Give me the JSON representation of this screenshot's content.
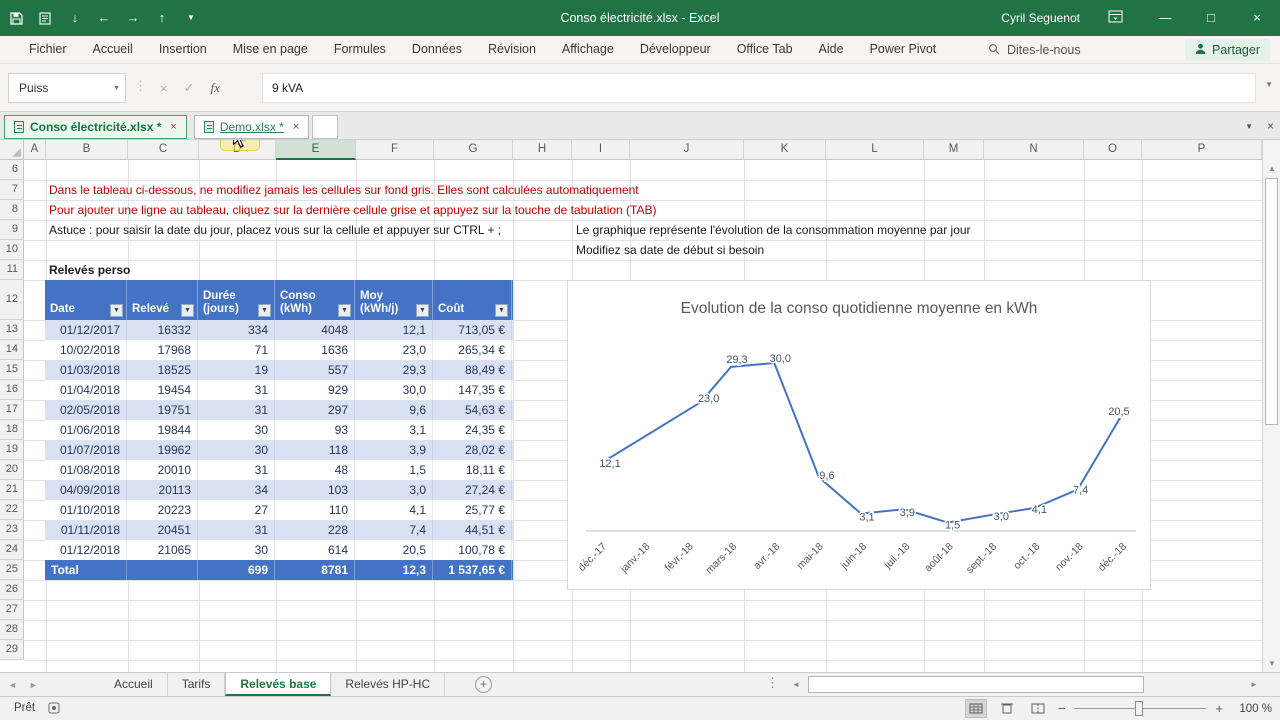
{
  "title_bar": {
    "title": "Conso électricité.xlsx - Excel",
    "user": "Cyril Seguenot"
  },
  "ribbon": {
    "tabs": [
      "Fichier",
      "Accueil",
      "Insertion",
      "Mise en page",
      "Formules",
      "Données",
      "Révision",
      "Affichage",
      "Développeur",
      "Office Tab",
      "Aide",
      "Power Pivot"
    ],
    "tell_me": "Dites-le-nous",
    "share": "Partager"
  },
  "formula_bar": {
    "name_box": "Puiss",
    "value": "9 kVA"
  },
  "workbook_tab_bar": {
    "tabs": [
      {
        "label": "Conso électricité.xlsx *",
        "active": true
      },
      {
        "label": "Demo.xlsx *",
        "active": false
      }
    ]
  },
  "sheet": {
    "columns": [
      "A",
      "B",
      "C",
      "D",
      "E",
      "F",
      "G",
      "H",
      "I",
      "J",
      "K",
      "L",
      "M",
      "N",
      "O",
      "P"
    ],
    "selected_column": "E",
    "rows_start": 6,
    "rows_end": 29
  },
  "messages": {
    "row7": "Dans le tableau ci-dessous, ne modifiez jamais les cellules sur fond gris. Elles sont calculées automatiquement",
    "row8": "Pour ajouter une ligne au tableau, cliquez sur la dernière cellule grise et appuyez sur la touche de tabulation (TAB)",
    "row9": "Astuce : pour saisir la date du jour, placez vous sur la cellule et appuyer sur CTRL + ;",
    "row9_right": "Le graphique représente l'évolution de la consommation moyenne par jour",
    "row10_right": "Modifiez sa date de début si besoin",
    "section_title": "Relevés perso"
  },
  "table": {
    "headers": [
      "Date",
      "Relevé",
      "Durée (jours)",
      "Conso (kWh)",
      "Moy (kWh/j)",
      "Coût"
    ],
    "rows": [
      [
        "01/12/2017",
        "16332",
        "334",
        "4048",
        "12,1",
        "713,05 €"
      ],
      [
        "10/02/2018",
        "17968",
        "71",
        "1636",
        "23,0",
        "265,34 €"
      ],
      [
        "01/03/2018",
        "18525",
        "19",
        "557",
        "29,3",
        "88,49 €"
      ],
      [
        "01/04/2018",
        "19454",
        "31",
        "929",
        "30,0",
        "147,35 €"
      ],
      [
        "02/05/2018",
        "19751",
        "31",
        "297",
        "9,6",
        "54,63 €"
      ],
      [
        "01/06/2018",
        "19844",
        "30",
        "93",
        "3,1",
        "24,35 €"
      ],
      [
        "01/07/2018",
        "19962",
        "30",
        "118",
        "3,9",
        "28,02 €"
      ],
      [
        "01/08/2018",
        "20010",
        "31",
        "48",
        "1,5",
        "18,11 €"
      ],
      [
        "04/09/2018",
        "20113",
        "34",
        "103",
        "3,0",
        "27,24 €"
      ],
      [
        "01/10/2018",
        "20223",
        "27",
        "110",
        "4,1",
        "25,77 €"
      ],
      [
        "01/11/2018",
        "20451",
        "31",
        "228",
        "7,4",
        "44,51 €"
      ],
      [
        "01/12/2018",
        "21065",
        "30",
        "614",
        "20,5",
        "100,78 €"
      ]
    ],
    "total": [
      "Total",
      "",
      "699",
      "8781",
      "12,3",
      "1 537,65 €"
    ]
  },
  "chart_data": {
    "type": "line",
    "title": "Evolution de la conso quotidienne moyenne en kWh",
    "x_tick_labels": [
      "déc.-17",
      "janv.-18",
      "févr.-18",
      "mars-18",
      "avr.-18",
      "mai-18",
      "juin-18",
      "juil.-18",
      "août-18",
      "sept.-18",
      "oct.-18",
      "nov.-18",
      "déc.-18"
    ],
    "x_axis_span_months": 12,
    "series": [
      {
        "name": "Moy (kWh/j)",
        "x_months": [
          0,
          2.3,
          3,
          4,
          5.03,
          6,
          7,
          8,
          9.1,
          10,
          11,
          12
        ],
        "values": [
          12.1,
          23.0,
          29.3,
          30.0,
          9.6,
          3.1,
          3.9,
          1.5,
          3.0,
          4.1,
          7.4,
          20.5
        ],
        "point_labels": [
          "12,1",
          "23,0",
          "29,3",
          "30,0",
          "9,6",
          "3,1",
          "3,9",
          "1,5",
          "3,0",
          "4,1",
          "7,4",
          "20,5"
        ]
      }
    ],
    "ylim": [
      0,
      30
    ],
    "gridlines": false,
    "legend": "none",
    "line_color": "#4472C4",
    "label_color": "#44546A",
    "axis_text_color": "#595959"
  },
  "sheet_tab_bar": {
    "tabs": [
      {
        "label": "Accueil",
        "active": false
      },
      {
        "label": "Tarifs",
        "active": false
      },
      {
        "label": "Relevés base",
        "active": true
      },
      {
        "label": "Relevés HP-HC",
        "active": false
      }
    ]
  },
  "status_bar": {
    "mode": "Prêt",
    "zoom": "100 %"
  },
  "colors": {
    "titlebar_green": "#217346",
    "table_header_blue": "#4472C4",
    "band_blue": "#D9E1F2",
    "warning_red": "#C00000"
  }
}
